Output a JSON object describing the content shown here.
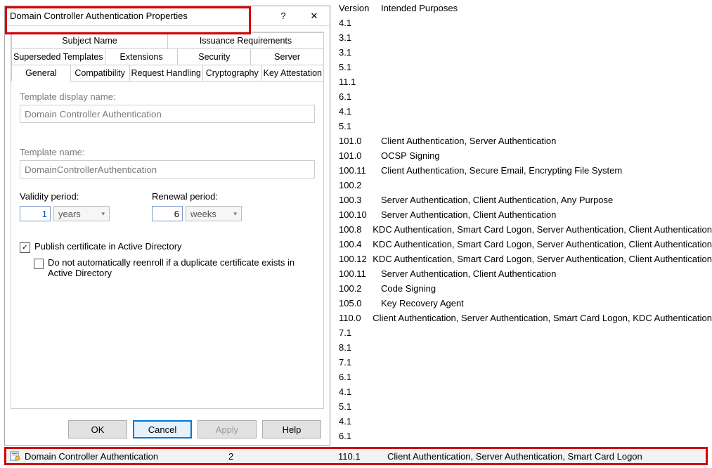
{
  "list_headers": {
    "version": "Version",
    "purposes": "Intended Purposes"
  },
  "list_rows": [
    {
      "v": "4.1",
      "p": ""
    },
    {
      "v": "3.1",
      "p": ""
    },
    {
      "v": "3.1",
      "p": ""
    },
    {
      "v": "5.1",
      "p": ""
    },
    {
      "v": "11.1",
      "p": ""
    },
    {
      "v": "6.1",
      "p": ""
    },
    {
      "v": "4.1",
      "p": ""
    },
    {
      "v": "5.1",
      "p": ""
    },
    {
      "v": "101.0",
      "p": "Client Authentication, Server Authentication"
    },
    {
      "v": "101.0",
      "p": "OCSP Signing"
    },
    {
      "v": "100.11",
      "p": "Client Authentication, Secure Email, Encrypting File System"
    },
    {
      "v": "100.2",
      "p": ""
    },
    {
      "v": "100.3",
      "p": "Server Authentication, Client Authentication, Any Purpose"
    },
    {
      "v": "100.10",
      "p": "Server Authentication, Client Authentication"
    },
    {
      "v": "100.8",
      "p": "KDC Authentication, Smart Card Logon, Server Authentication, Client Authentication"
    },
    {
      "v": "100.4",
      "p": "KDC Authentication, Smart Card Logon, Server Authentication, Client Authentication"
    },
    {
      "v": "100.12",
      "p": "KDC Authentication, Smart Card Logon, Server Authentication, Client Authentication"
    },
    {
      "v": "100.11",
      "p": "Server Authentication, Client Authentication"
    },
    {
      "v": "100.2",
      "p": "Code Signing"
    },
    {
      "v": "105.0",
      "p": "Key Recovery Agent"
    },
    {
      "v": "110.0",
      "p": "Client Authentication, Server Authentication, Smart Card Logon, KDC Authentication"
    },
    {
      "v": "7.1",
      "p": ""
    },
    {
      "v": "8.1",
      "p": ""
    },
    {
      "v": "7.1",
      "p": ""
    },
    {
      "v": "6.1",
      "p": ""
    },
    {
      "v": "4.1",
      "p": ""
    },
    {
      "v": "5.1",
      "p": ""
    },
    {
      "v": "4.1",
      "p": ""
    },
    {
      "v": "6.1",
      "p": ""
    }
  ],
  "dialog": {
    "title": "Domain Controller Authentication Properties",
    "help": "?",
    "close": "✕",
    "tabs_r1": [
      "Subject Name",
      "Issuance Requirements"
    ],
    "tabs_r2": [
      "Superseded Templates",
      "Extensions",
      "Security",
      "Server"
    ],
    "tabs_r3": [
      "General",
      "Compatibility",
      "Request Handling",
      "Cryptography",
      "Key Attestation"
    ],
    "active_tab": "General",
    "display_label": "Template display name:",
    "display_value": "Domain Controller Authentication",
    "name_label": "Template name:",
    "name_value": "DomainControllerAuthentication",
    "validity_label": "Validity period:",
    "validity_value": "1",
    "validity_unit": "years",
    "renewal_label": "Renewal period:",
    "renewal_value": "6",
    "renewal_unit": "weeks",
    "publish_checked": true,
    "publish_label": "Publish certificate in Active Directory",
    "dup_checked": false,
    "dup_label": "Do not automatically reenroll if a duplicate certificate exists in Active Directory",
    "buttons": {
      "ok": "OK",
      "cancel": "Cancel",
      "apply": "Apply",
      "help": "Help"
    }
  },
  "selected_row": {
    "name": "Domain Controller Authentication",
    "col2": "2",
    "version": "110.1",
    "purposes": "Client Authentication, Server Authentication, Smart Card Logon"
  }
}
